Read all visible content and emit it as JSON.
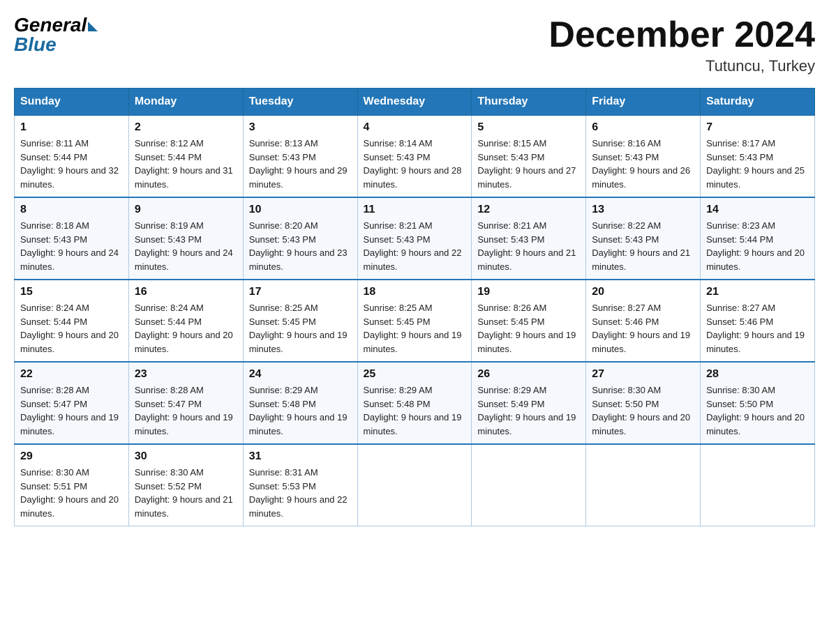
{
  "header": {
    "logo_general": "General",
    "logo_blue": "Blue",
    "title": "December 2024",
    "location": "Tutuncu, Turkey"
  },
  "days_of_week": [
    "Sunday",
    "Monday",
    "Tuesday",
    "Wednesday",
    "Thursday",
    "Friday",
    "Saturday"
  ],
  "weeks": [
    [
      {
        "day": "1",
        "sunrise": "8:11 AM",
        "sunset": "5:44 PM",
        "daylight": "9 hours and 32 minutes."
      },
      {
        "day": "2",
        "sunrise": "8:12 AM",
        "sunset": "5:44 PM",
        "daylight": "9 hours and 31 minutes."
      },
      {
        "day": "3",
        "sunrise": "8:13 AM",
        "sunset": "5:43 PM",
        "daylight": "9 hours and 29 minutes."
      },
      {
        "day": "4",
        "sunrise": "8:14 AM",
        "sunset": "5:43 PM",
        "daylight": "9 hours and 28 minutes."
      },
      {
        "day": "5",
        "sunrise": "8:15 AM",
        "sunset": "5:43 PM",
        "daylight": "9 hours and 27 minutes."
      },
      {
        "day": "6",
        "sunrise": "8:16 AM",
        "sunset": "5:43 PM",
        "daylight": "9 hours and 26 minutes."
      },
      {
        "day": "7",
        "sunrise": "8:17 AM",
        "sunset": "5:43 PM",
        "daylight": "9 hours and 25 minutes."
      }
    ],
    [
      {
        "day": "8",
        "sunrise": "8:18 AM",
        "sunset": "5:43 PM",
        "daylight": "9 hours and 24 minutes."
      },
      {
        "day": "9",
        "sunrise": "8:19 AM",
        "sunset": "5:43 PM",
        "daylight": "9 hours and 24 minutes."
      },
      {
        "day": "10",
        "sunrise": "8:20 AM",
        "sunset": "5:43 PM",
        "daylight": "9 hours and 23 minutes."
      },
      {
        "day": "11",
        "sunrise": "8:21 AM",
        "sunset": "5:43 PM",
        "daylight": "9 hours and 22 minutes."
      },
      {
        "day": "12",
        "sunrise": "8:21 AM",
        "sunset": "5:43 PM",
        "daylight": "9 hours and 21 minutes."
      },
      {
        "day": "13",
        "sunrise": "8:22 AM",
        "sunset": "5:43 PM",
        "daylight": "9 hours and 21 minutes."
      },
      {
        "day": "14",
        "sunrise": "8:23 AM",
        "sunset": "5:44 PM",
        "daylight": "9 hours and 20 minutes."
      }
    ],
    [
      {
        "day": "15",
        "sunrise": "8:24 AM",
        "sunset": "5:44 PM",
        "daylight": "9 hours and 20 minutes."
      },
      {
        "day": "16",
        "sunrise": "8:24 AM",
        "sunset": "5:44 PM",
        "daylight": "9 hours and 20 minutes."
      },
      {
        "day": "17",
        "sunrise": "8:25 AM",
        "sunset": "5:45 PM",
        "daylight": "9 hours and 19 minutes."
      },
      {
        "day": "18",
        "sunrise": "8:25 AM",
        "sunset": "5:45 PM",
        "daylight": "9 hours and 19 minutes."
      },
      {
        "day": "19",
        "sunrise": "8:26 AM",
        "sunset": "5:45 PM",
        "daylight": "9 hours and 19 minutes."
      },
      {
        "day": "20",
        "sunrise": "8:27 AM",
        "sunset": "5:46 PM",
        "daylight": "9 hours and 19 minutes."
      },
      {
        "day": "21",
        "sunrise": "8:27 AM",
        "sunset": "5:46 PM",
        "daylight": "9 hours and 19 minutes."
      }
    ],
    [
      {
        "day": "22",
        "sunrise": "8:28 AM",
        "sunset": "5:47 PM",
        "daylight": "9 hours and 19 minutes."
      },
      {
        "day": "23",
        "sunrise": "8:28 AM",
        "sunset": "5:47 PM",
        "daylight": "9 hours and 19 minutes."
      },
      {
        "day": "24",
        "sunrise": "8:29 AM",
        "sunset": "5:48 PM",
        "daylight": "9 hours and 19 minutes."
      },
      {
        "day": "25",
        "sunrise": "8:29 AM",
        "sunset": "5:48 PM",
        "daylight": "9 hours and 19 minutes."
      },
      {
        "day": "26",
        "sunrise": "8:29 AM",
        "sunset": "5:49 PM",
        "daylight": "9 hours and 19 minutes."
      },
      {
        "day": "27",
        "sunrise": "8:30 AM",
        "sunset": "5:50 PM",
        "daylight": "9 hours and 20 minutes."
      },
      {
        "day": "28",
        "sunrise": "8:30 AM",
        "sunset": "5:50 PM",
        "daylight": "9 hours and 20 minutes."
      }
    ],
    [
      {
        "day": "29",
        "sunrise": "8:30 AM",
        "sunset": "5:51 PM",
        "daylight": "9 hours and 20 minutes."
      },
      {
        "day": "30",
        "sunrise": "8:30 AM",
        "sunset": "5:52 PM",
        "daylight": "9 hours and 21 minutes."
      },
      {
        "day": "31",
        "sunrise": "8:31 AM",
        "sunset": "5:53 PM",
        "daylight": "9 hours and 22 minutes."
      },
      null,
      null,
      null,
      null
    ]
  ]
}
